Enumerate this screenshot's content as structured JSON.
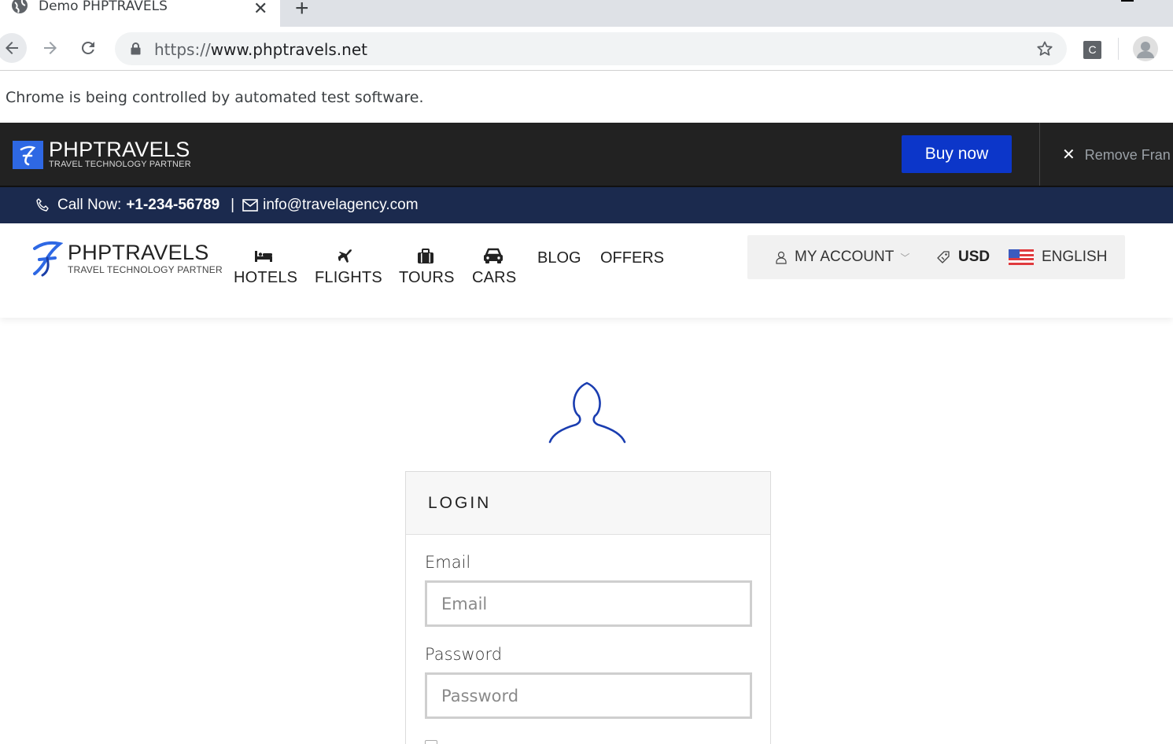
{
  "browser": {
    "tab_title": "Demo PHPTRAVELS",
    "url_scheme": "https://",
    "url_host": "www.phptravels.net",
    "profile_extension_letter": "C",
    "infobar_text": "Chrome is being controlled by automated test software."
  },
  "demo_bar": {
    "logo_name": "PHPTRAVELS",
    "logo_tagline": "TRAVEL TECHNOLOGY PARTNER",
    "buy_label": "Buy now",
    "remove_label": "Remove Fran",
    "buy_color": "#0c36c9"
  },
  "contact": {
    "call_label": "Call Now:",
    "phone": "+1-234-56789",
    "separator": "|",
    "email": "info@travelagency.com"
  },
  "header": {
    "logo_name": "PHPTRAVELS",
    "logo_tagline": "TRAVEL TECHNOLOGY PARTNER",
    "nav": {
      "hotels": "HOTELS",
      "flights": "FLIGHTS",
      "tours": "TOURS",
      "cars": "CARS",
      "blog": "BLOG",
      "offers": "OFFERS"
    },
    "account": {
      "my_account": "MY ACCOUNT",
      "currency": "USD",
      "language": "ENGLISH"
    }
  },
  "login": {
    "title": "LOGIN",
    "email_label": "Email",
    "email_placeholder": "Email",
    "password_label": "Password",
    "password_placeholder": "Password"
  }
}
